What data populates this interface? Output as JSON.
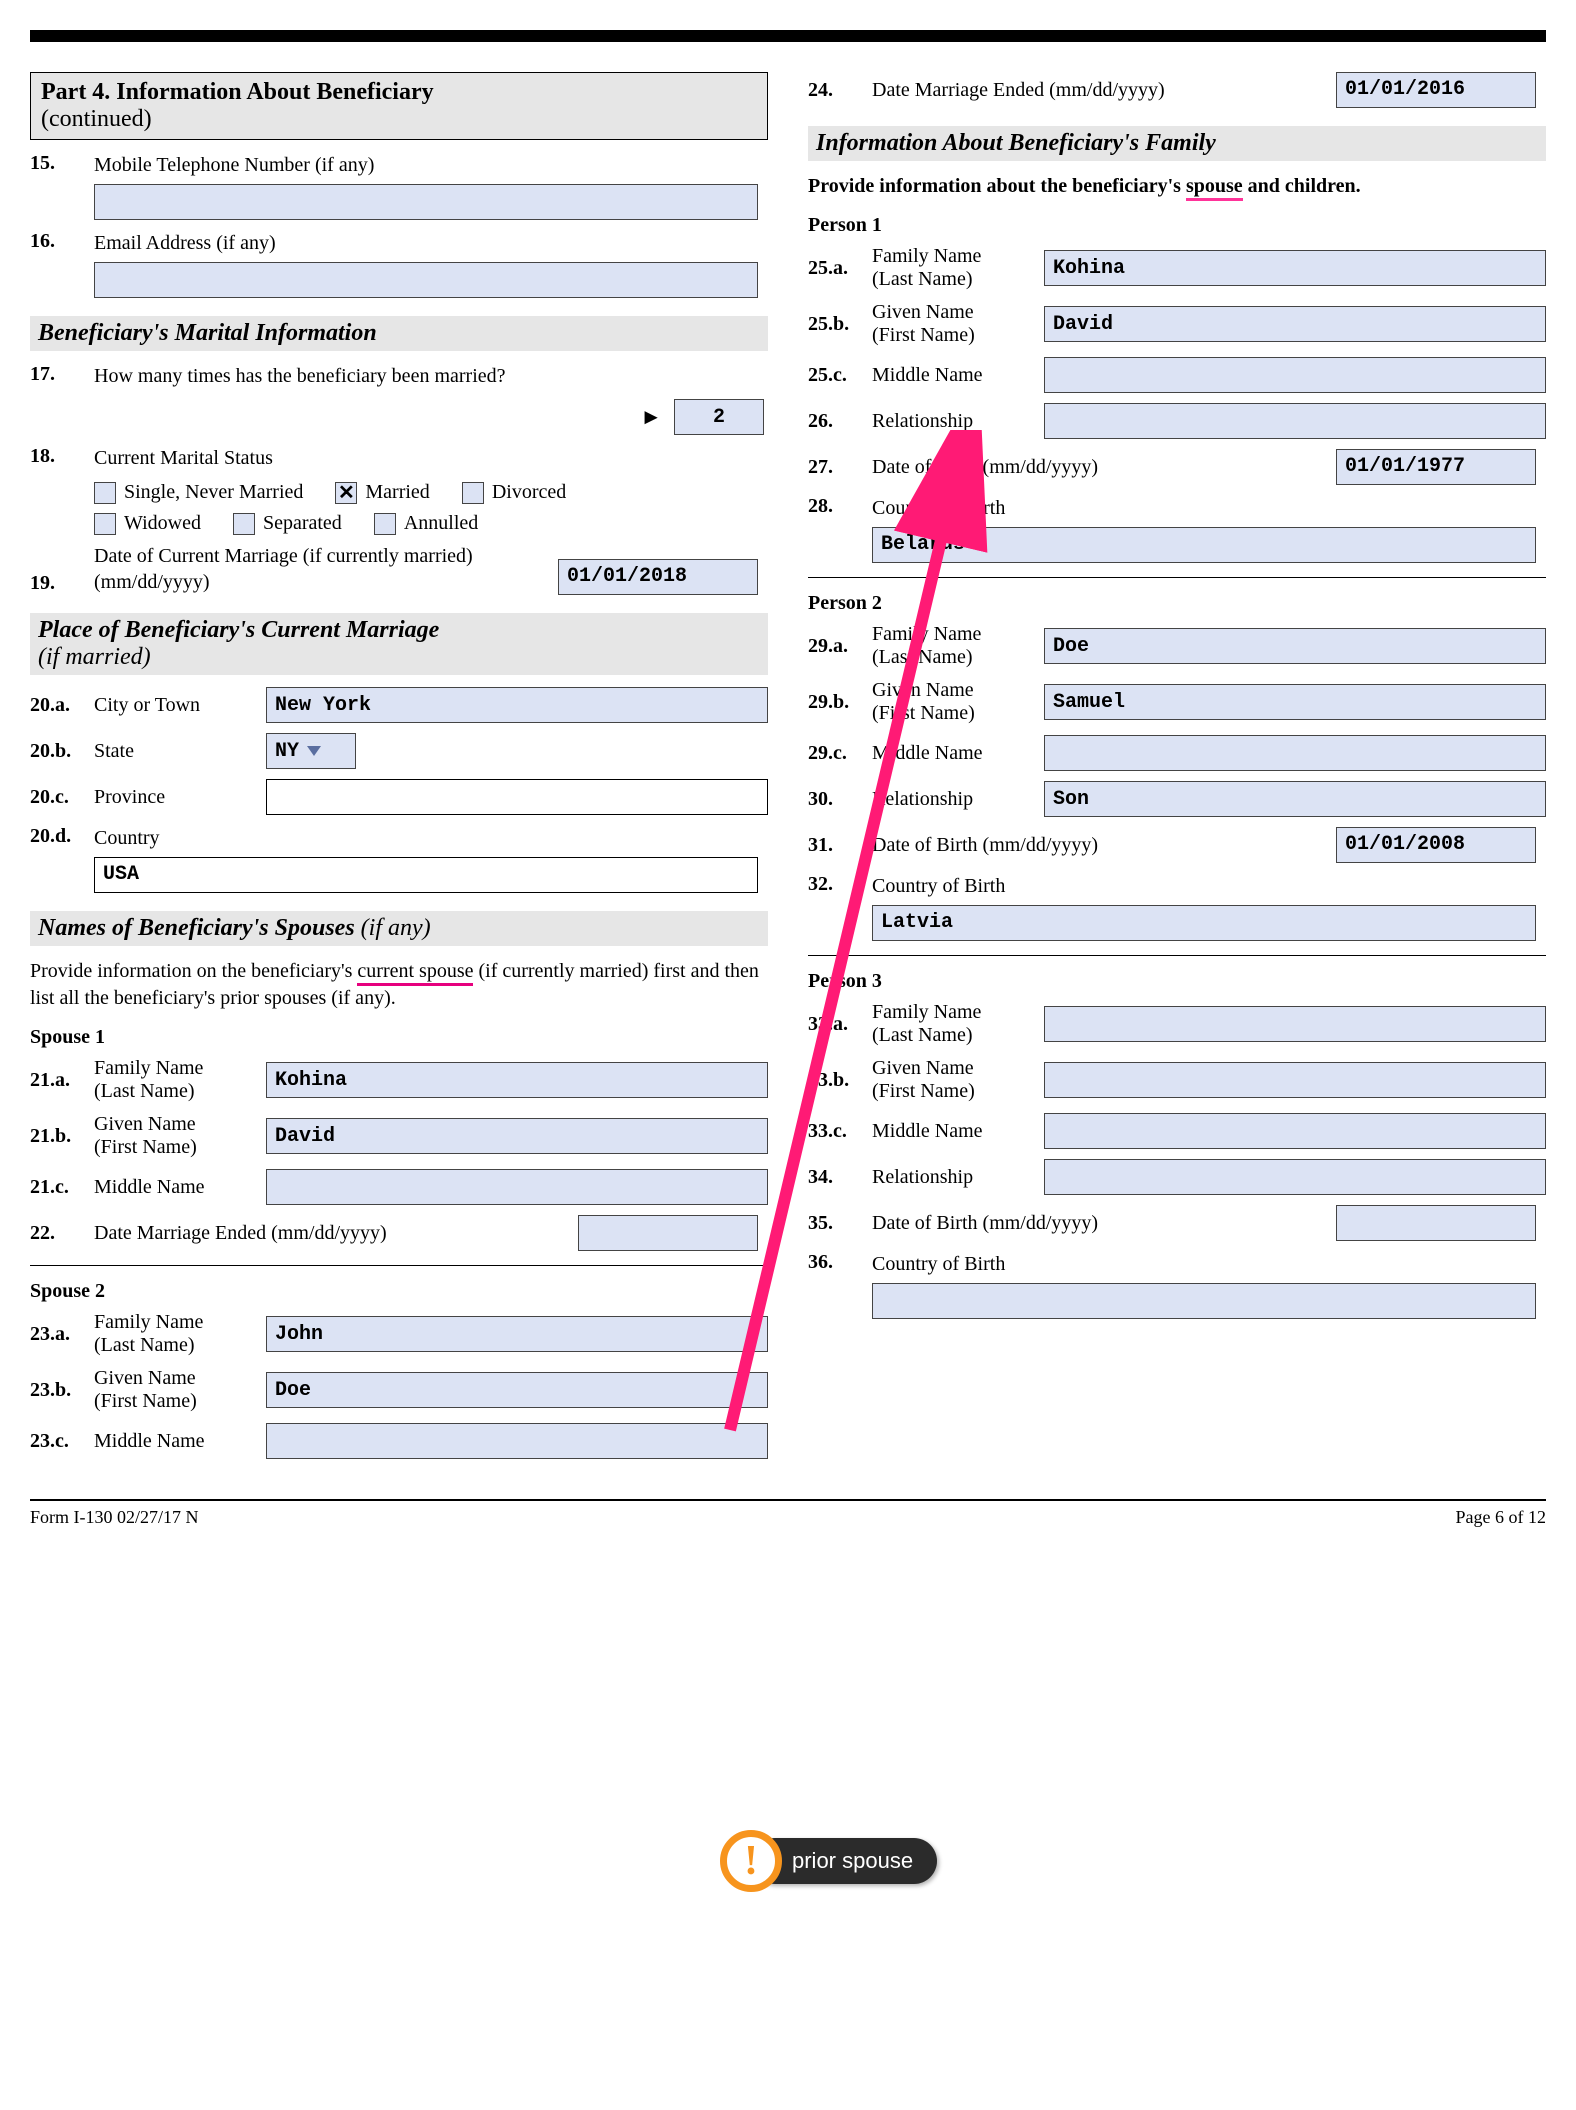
{
  "header": {
    "part_title": "Part 4.  Information About Beneficiary",
    "continued": "(continued)"
  },
  "left": {
    "q15": {
      "num": "15.",
      "label": "Mobile Telephone Number (if any)",
      "value": ""
    },
    "q16": {
      "num": "16.",
      "label": "Email Address (if any)",
      "value": ""
    },
    "marital_header": "Beneficiary's Marital Information",
    "q17": {
      "num": "17.",
      "label": "How many times has the beneficiary been married?",
      "value": "2"
    },
    "q18": {
      "num": "18.",
      "label": "Current Marital Status",
      "opts": {
        "single": "Single, Never Married",
        "married": "Married",
        "divorced": "Divorced",
        "widowed": "Widowed",
        "separated": "Separated",
        "annulled": "Annulled"
      },
      "checked": "married"
    },
    "q19": {
      "num": "19.",
      "label": "Date of  Current Marriage (if currently married) (mm/dd/yyyy)",
      "value": "01/01/2018"
    },
    "place_header": "Place of Beneficiary's Current Marriage",
    "place_header_paren": "(if married)",
    "q20a": {
      "num": "20.a.",
      "label": "City or Town",
      "value": "New York"
    },
    "q20b": {
      "num": "20.b.",
      "label": "State",
      "value": "NY"
    },
    "q20c": {
      "num": "20.c.",
      "label": "Province",
      "value": ""
    },
    "q20d": {
      "num": "20.d.",
      "label": "Country",
      "value": "USA"
    },
    "spouses_header": "Names of Beneficiary's Spouses",
    "spouses_header_paren": "(if any)",
    "spouses_instruction_pre": "Provide information on the beneficiary's ",
    "spouses_instruction_underline": "current spouse",
    "spouses_instruction_post": " (if currently married) first and then list all the beneficiary's prior spouses (if any).",
    "spouse1_label": "Spouse 1",
    "q21a": {
      "num": "21.a.",
      "label": "Family Name",
      "sub": "(Last Name)",
      "value": "Kohina"
    },
    "q21b": {
      "num": "21.b.",
      "label": "Given Name",
      "sub": "(First Name)",
      "value": "David"
    },
    "q21c": {
      "num": "21.c.",
      "label": "Middle Name",
      "value": ""
    },
    "q22": {
      "num": "22.",
      "label": "Date Marriage Ended (mm/dd/yyyy)",
      "value": ""
    },
    "spouse2_label": "Spouse 2",
    "q23a": {
      "num": "23.a.",
      "label": "Family Name",
      "sub": "(Last Name)",
      "value": "John"
    },
    "q23b": {
      "num": "23.b.",
      "label": "Given Name",
      "sub": "(First Name)",
      "value": "Doe"
    },
    "q23c": {
      "num": "23.c.",
      "label": "Middle Name",
      "value": ""
    }
  },
  "right": {
    "q24": {
      "num": "24.",
      "label": "Date Marriage Ended (mm/dd/yyyy)",
      "value": "01/01/2016"
    },
    "family_header": "Information About Beneficiary's Family",
    "family_instruction_pre": "Provide information about the beneficiary's ",
    "family_instruction_underline": "spouse",
    "family_instruction_post": " and children.",
    "person1_label": "Person 1",
    "q25a": {
      "num": "25.a.",
      "label": "Family Name",
      "sub": "(Last Name)",
      "value": "Kohina"
    },
    "q25b": {
      "num": "25.b.",
      "label": "Given Name",
      "sub": "(First Name)",
      "value": "David"
    },
    "q25c": {
      "num": "25.c.",
      "label": "Middle Name",
      "value": ""
    },
    "q26": {
      "num": "26.",
      "label": "Relationship",
      "value": ""
    },
    "q27": {
      "num": "27.",
      "label": "Date of Birth (mm/dd/yyyy)",
      "value": "01/01/1977"
    },
    "q28": {
      "num": "28.",
      "label": "Country of Birth",
      "value": "Belarus"
    },
    "person2_label": "Person 2",
    "q29a": {
      "num": "29.a.",
      "label": "Family Name",
      "sub": "(Last Name)",
      "value": "Doe"
    },
    "q29b": {
      "num": "29.b.",
      "label": "Given Name",
      "sub": "(First Name)",
      "value": "Samuel"
    },
    "q29c": {
      "num": "29.c.",
      "label": "Middle Name",
      "value": ""
    },
    "q30": {
      "num": "30.",
      "label": "Relationship",
      "value": "Son"
    },
    "q31": {
      "num": "31.",
      "label": "Date of Birth (mm/dd/yyyy)",
      "value": "01/01/2008"
    },
    "q32": {
      "num": "32.",
      "label": "Country of Birth",
      "value": "Latvia"
    },
    "person3_label": "Person 3",
    "q33a": {
      "num": "33.a.",
      "label": "Family Name",
      "sub": "(Last Name)",
      "value": ""
    },
    "q33b": {
      "num": "33.b.",
      "label": "Given Name",
      "sub": "(First Name)",
      "value": ""
    },
    "q33c": {
      "num": "33.c.",
      "label": "Middle Name",
      "value": ""
    },
    "q34": {
      "num": "34.",
      "label": "Relationship",
      "value": ""
    },
    "q35": {
      "num": "35.",
      "label": "Date of Birth (mm/dd/yyyy)",
      "value": ""
    },
    "q36": {
      "num": "36.",
      "label": "Country of Birth",
      "value": ""
    }
  },
  "annotation": {
    "badge_text": "prior spouse"
  },
  "footer": {
    "left": "Form I-130   02/27/17   N",
    "right": "Page 6 of 12"
  }
}
